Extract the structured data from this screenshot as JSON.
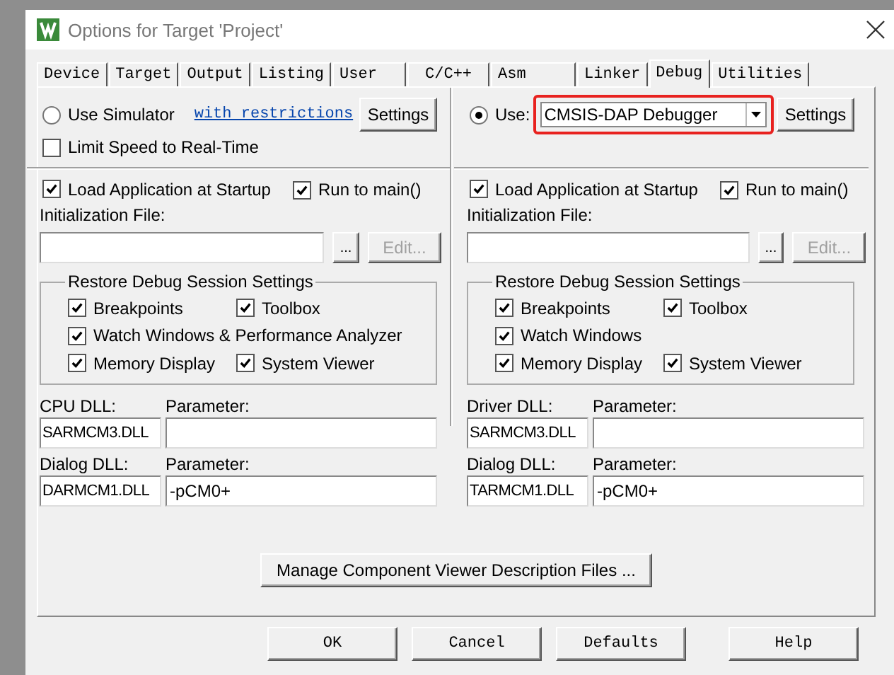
{
  "window": {
    "title": "Options for Target 'Project'"
  },
  "tabs": [
    {
      "label": "Device",
      "selected": false
    },
    {
      "label": "Target",
      "selected": false
    },
    {
      "label": "Output",
      "selected": false
    },
    {
      "label": "Listing",
      "selected": false
    },
    {
      "label": "User",
      "selected": false
    },
    {
      "label": "C/C++",
      "selected": false
    },
    {
      "label": "Asm",
      "selected": false
    },
    {
      "label": "Linker",
      "selected": false
    },
    {
      "label": "Debug",
      "selected": true
    },
    {
      "label": "Utilities",
      "selected": false
    }
  ],
  "panels": [
    {
      "mode": {
        "label": "Use Simulator",
        "selected": false
      },
      "link": "with restrictions",
      "settings_button": "Settings",
      "limit_speed": {
        "label": "Limit Speed to Real-Time",
        "checked": false
      },
      "load_app": {
        "label": "Load Application at Startup",
        "checked": true
      },
      "run_to_main": {
        "label": "Run to main()",
        "checked": true
      },
      "init_file_label": "Initialization File:",
      "browse_button": "...",
      "edit_button": {
        "label": "Edit...",
        "disabled": true
      },
      "restore_group": {
        "title": "Restore Debug Session Settings",
        "rows": [
          [
            {
              "label": "Breakpoints",
              "checked": true
            },
            {
              "label": "Toolbox",
              "checked": true
            }
          ],
          [
            {
              "label": "Watch Windows & Performance Analyzer",
              "checked": true
            }
          ],
          [
            {
              "label": "Memory Display",
              "checked": true
            },
            {
              "label": "System Viewer",
              "checked": true
            }
          ]
        ]
      },
      "dll_rows": [
        {
          "label": "CPU DLL:",
          "value": "SARMCM3.DLL",
          "param_label": "Parameter:"
        },
        {
          "label": "Dialog DLL:",
          "value": "DARMCM1.DLL",
          "param_label": "Parameter:",
          "param_value": "-pCM0+"
        }
      ]
    },
    {
      "mode": {
        "label": "Use:",
        "selected": true
      },
      "debugger_dropdown": {
        "value": "CMSIS-DAP Debugger",
        "highlighted": true
      },
      "settings_button": "Settings",
      "load_app": {
        "label": "Load Application at Startup",
        "checked": true
      },
      "run_to_main": {
        "label": "Run to main()",
        "checked": true
      },
      "init_file_label": "Initialization File:",
      "browse_button": "...",
      "edit_button": {
        "label": "Edit...",
        "disabled": true
      },
      "restore_group": {
        "title": "Restore Debug Session Settings",
        "rows": [
          [
            {
              "label": "Breakpoints",
              "checked": true
            },
            {
              "label": "Toolbox",
              "checked": true
            }
          ],
          [
            {
              "label": "Watch Windows",
              "checked": true
            }
          ],
          [
            {
              "label": "Memory Display",
              "checked": true
            },
            {
              "label": "System Viewer",
              "checked": true
            }
          ]
        ]
      },
      "dll_rows": [
        {
          "label": "Driver DLL:",
          "value": "SARMCM3.DLL",
          "param_label": "Parameter:"
        },
        {
          "label": "Dialog DLL:",
          "value": "TARMCM1.DLL",
          "param_label": "Parameter:",
          "param_value": "-pCM0+"
        }
      ]
    }
  ],
  "manage_button": "Manage Component Viewer Description Files ...",
  "buttons": [
    "OK",
    "Cancel",
    "Defaults",
    "Help"
  ]
}
